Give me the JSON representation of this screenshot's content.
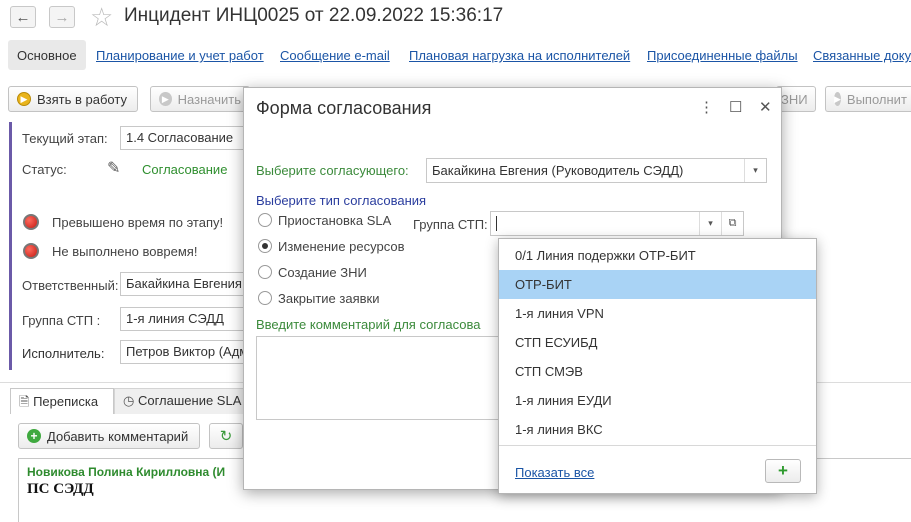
{
  "window": {
    "title": "Инцидент ИНЦ0025 от 22.09.2022 15:36:17",
    "back_icon": "←",
    "forward_icon": "→",
    "star_icon": "☆"
  },
  "tabs": {
    "active": "Основное",
    "links": [
      "Планирование и учет работ",
      "Сообщение e-mail",
      "Плановая нагрузка на исполнителей",
      "Присоединенные файлы",
      "Связанные доку"
    ]
  },
  "toolbar": {
    "take_label": "Взять в работу",
    "assign_label": "Назначить",
    "zni_label": "ЗНИ",
    "execute_label": "Выполнит"
  },
  "form": {
    "stage_label": "Текущий этап:",
    "stage_value": "1.4 Согласование",
    "status_label": "Статус:",
    "status_value": "Согласование",
    "alert1": "Превышено время по этапу!",
    "alert2": "Не выполнено вовремя!",
    "responsible_label": "Ответственный:",
    "responsible_value": "Бакайкина Евгения",
    "group_label": "Группа СТП :",
    "group_value": "1-я линия СЭДД",
    "executor_label": "Исполнитель:",
    "executor_value": "Петров Виктор (Адм"
  },
  "bottom": {
    "tab_correspondence": "Переписка",
    "tab_sla": "Соглашение SLA",
    "add_comment_label": "Добавить комментарий",
    "message_author": "Новикова Полина Кирилловна (И",
    "message_text": "ПС СЭДД"
  },
  "dialog": {
    "title": "Форма согласования",
    "approver_label": "Выберите согласующего:",
    "approver_value": "Бакайкина Евгения (Руководитель СЭДД)",
    "type_label": "Выберите тип согласования",
    "options": [
      "Приостановка SLA",
      "Изменение ресурсов",
      "Создание ЗНИ",
      "Закрытие заявки"
    ],
    "selected_option": "Изменение ресурсов",
    "group_label": "Группа СТП:",
    "group_value": "",
    "comment_label": "Введите комментарий для согласова",
    "menu_icon": "⋮",
    "maximize_icon": "☐",
    "close_icon": "✕"
  },
  "dropdown": {
    "items": [
      "0/1 Линия подержки ОТР-БИТ",
      "ОТР-БИТ",
      "1-я линия VPN",
      "СТП ЕСУИБД",
      "СТП СМЭВ",
      "1-я линия ЕУДИ",
      "1-я линия ВКС"
    ],
    "selected": "ОТР-БИТ",
    "show_all": "Показать все",
    "add_icon": "+"
  }
}
